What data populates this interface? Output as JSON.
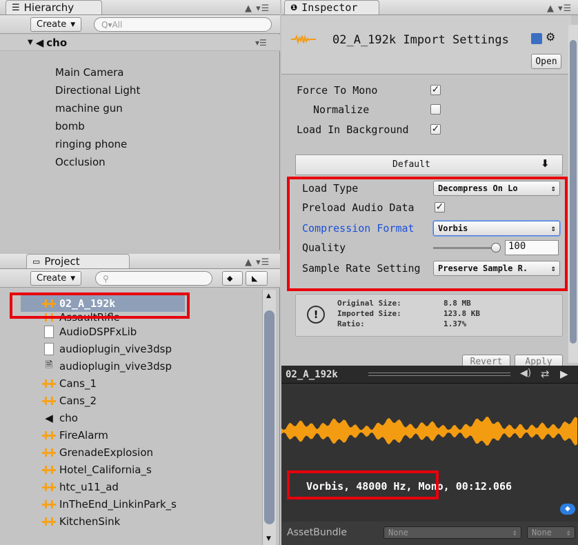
{
  "hierarchy": {
    "tab_label": "Hierarchy",
    "create_label": "Create",
    "search_placeholder": "Q▾All",
    "scene_name": "cho",
    "items": [
      "Main Camera",
      "Directional Light",
      "machine gun",
      "bomb",
      "ringing phone",
      "Occlusion"
    ]
  },
  "project": {
    "tab_label": "Project",
    "create_label": "Create",
    "items": [
      {
        "name": "02_A_192k",
        "icon": "audio-clip-icon"
      },
      {
        "name": "AssaultRifle",
        "icon": "audio-clip-icon"
      },
      {
        "name": "AudioDSPFxLib",
        "icon": "document-icon"
      },
      {
        "name": "audioplugin_vive3dsp",
        "icon": "document-icon"
      },
      {
        "name": "audioplugin_vive3dsp",
        "icon": "dll-icon"
      },
      {
        "name": "Cans_1",
        "icon": "audio-clip-icon"
      },
      {
        "name": "Cans_2",
        "icon": "audio-clip-icon"
      },
      {
        "name": "cho",
        "icon": "unity-scene-icon"
      },
      {
        "name": "FireAlarm",
        "icon": "audio-clip-icon"
      },
      {
        "name": "GrenadeExplosion",
        "icon": "audio-clip-icon"
      },
      {
        "name": "Hotel_California_s",
        "icon": "audio-clip-icon"
      },
      {
        "name": "htc_u11_ad",
        "icon": "audio-clip-icon"
      },
      {
        "name": "InTheEnd_LinkinPark_s",
        "icon": "audio-clip-icon"
      },
      {
        "name": "KitchenSink",
        "icon": "audio-clip-icon"
      }
    ]
  },
  "inspector": {
    "tab_label": "Inspector",
    "title": "02_A_192k Import Settings",
    "open_label": "Open",
    "force_to_mono_label": "Force To Mono",
    "force_to_mono_checked": true,
    "normalize_label": "Normalize",
    "normalize_checked": false,
    "load_in_background_label": "Load In Background",
    "load_in_background_checked": true,
    "platform_tab": "Default",
    "load_type_label": "Load Type",
    "load_type_value": "Decompress On Lo",
    "preload_label": "Preload Audio Data",
    "preload_checked": true,
    "compression_label": "Compression Format",
    "compression_value": "Vorbis",
    "quality_label": "Quality",
    "quality_value": "100",
    "quality_fraction": 1.0,
    "sample_rate_label": "Sample Rate Setting",
    "sample_rate_value": "Preserve Sample R.",
    "original_size_label": "Original Size:",
    "original_size_value": "8.8 MB",
    "imported_size_label": "Imported Size:",
    "imported_size_value": "123.8 KB",
    "ratio_label": "Ratio:",
    "ratio_value": "1.37%",
    "revert_label": "Revert",
    "apply_label": "Apply"
  },
  "preview": {
    "clip_name": "02_A_192k",
    "info": "Vorbis, 48000 Hz, Mono, 00:12.066",
    "waveform_color": "#f39c12"
  },
  "assetbundle": {
    "label": "AssetBundle",
    "value": "None",
    "variant": "None"
  },
  "colors": {
    "highlight": "#e8000b",
    "link_blue": "#1a4fd8",
    "selection": "#8f9fb8"
  }
}
